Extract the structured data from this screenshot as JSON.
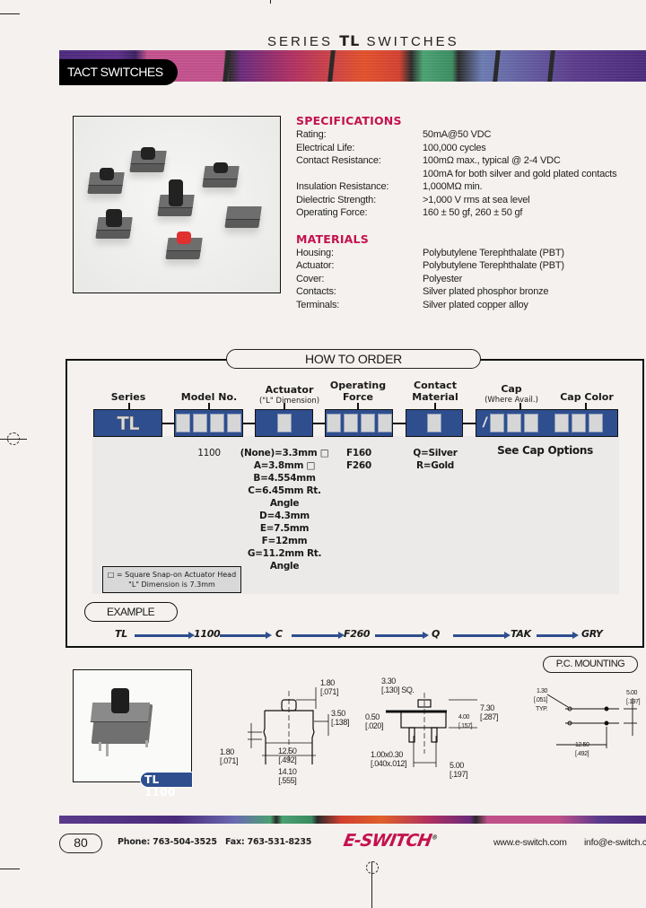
{
  "header": {
    "series_prefix": "SERIES",
    "series_code": "TL",
    "series_suffix": "SWITCHES",
    "category": "TACT SWITCHES"
  },
  "specifications": {
    "heading": "SPECIFICATIONS",
    "rows": [
      {
        "label": "Rating:",
        "value": "50mA@50 VDC"
      },
      {
        "label": "Electrical Life:",
        "value": "100,000 cycles"
      },
      {
        "label": "Contact Resistance:",
        "value": "100mΩ max., typical @ 2-4 VDC"
      },
      {
        "label": "",
        "value": "100mA for both silver and gold plated contacts"
      },
      {
        "label": "Insulation Resistance:",
        "value": "1,000MΩ min."
      },
      {
        "label": "Dielectric Strength:",
        "value": ">1,000 V rms at sea level"
      },
      {
        "label": "Operating Force:",
        "value": "160 ± 50 gf, 260 ± 50 gf"
      }
    ]
  },
  "materials": {
    "heading": "MATERIALS",
    "rows": [
      {
        "label": "Housing:",
        "value": "Polybutylene Terephthalate (PBT)"
      },
      {
        "label": "Actuator:",
        "value": "Polybutylene Terephthalate (PBT)"
      },
      {
        "label": "Cover:",
        "value": "Polyester"
      },
      {
        "label": "Contacts:",
        "value": "Silver plated phosphor bronze"
      },
      {
        "label": "Terminals:",
        "value": "Silver plated copper alloy"
      }
    ]
  },
  "how_to_order": {
    "title": "HOW TO ORDER",
    "columns": {
      "series": {
        "label": "Series",
        "value": "TL"
      },
      "model": {
        "label": "Model No.",
        "options": [
          "1100"
        ]
      },
      "actuator": {
        "label": "Actuator",
        "sub": "(\"L\" Dimension)",
        "options": [
          "(None)=3.3mm □",
          "A=3.8mm □",
          "B=4.554mm",
          "C=6.45mm Rt.",
          "Angle",
          "D=4.3mm",
          "E=7.5mm",
          "F=12mm",
          "G=11.2mm Rt.",
          "Angle"
        ]
      },
      "force": {
        "label": "Operating",
        "label2": "Force",
        "options": [
          "F160",
          "F260"
        ]
      },
      "contact": {
        "label": "Contact",
        "label2": "Material",
        "options": [
          "Q=Silver",
          "R=Gold"
        ]
      },
      "cap": {
        "label": "Cap",
        "sub": "(Where Avail.)",
        "slash": "/"
      },
      "cap_color": {
        "label": "Cap Color"
      },
      "cap_note": "See Cap Options"
    },
    "note_line1": "□ = Square Snap-on Actuator Head",
    "note_line2": "\"L\" Dimension is 7.3mm",
    "example_label": "EXAMPLE",
    "example": [
      "TL",
      "1100",
      "C",
      "F260",
      "Q",
      "TAK",
      "GRY"
    ]
  },
  "product": {
    "tag": "TL 1100"
  },
  "dimensions": {
    "front": [
      {
        "mm": "1.80",
        "in": "[.071]"
      },
      {
        "mm": "3.50",
        "in": "[.138]"
      },
      {
        "mm": "1.80",
        "in": "[.071]"
      },
      {
        "mm": "12.50",
        "in": "[.492]"
      },
      {
        "mm": "14.10",
        "in": "[.555]"
      }
    ],
    "side": [
      {
        "mm": "3.30",
        "in": "[.130] SQ."
      },
      {
        "mm": "0.50",
        "in": "[.020]"
      },
      {
        "mm": "4.00",
        "in": "[.157]"
      },
      {
        "mm": "7.30",
        "in": "[.287]"
      },
      {
        "mm": "1.00x0.30",
        "in": "[.040x.012]"
      },
      {
        "mm": "5.00",
        "in": "[.197]"
      }
    ],
    "pc_mounting": {
      "title": "P.C. MOUNTING",
      "items": [
        {
          "mm": "1.30",
          "in": "[.051]",
          "extra": "TYP."
        },
        {
          "mm": "5.00",
          "in": "[.197]"
        },
        {
          "mm": "12.50",
          "in": "[.492]"
        }
      ]
    }
  },
  "footer": {
    "page": "80",
    "phone": "Phone: 763-504-3525",
    "fax": "Fax: 763-531-8235",
    "logo": "E-SWITCH",
    "website": "www.e-switch.com",
    "email": "info@e-switch.com"
  },
  "colors": {
    "accent": "#c4124f",
    "order_blue": "#2e4e8e",
    "background": "#f4f1ee"
  }
}
